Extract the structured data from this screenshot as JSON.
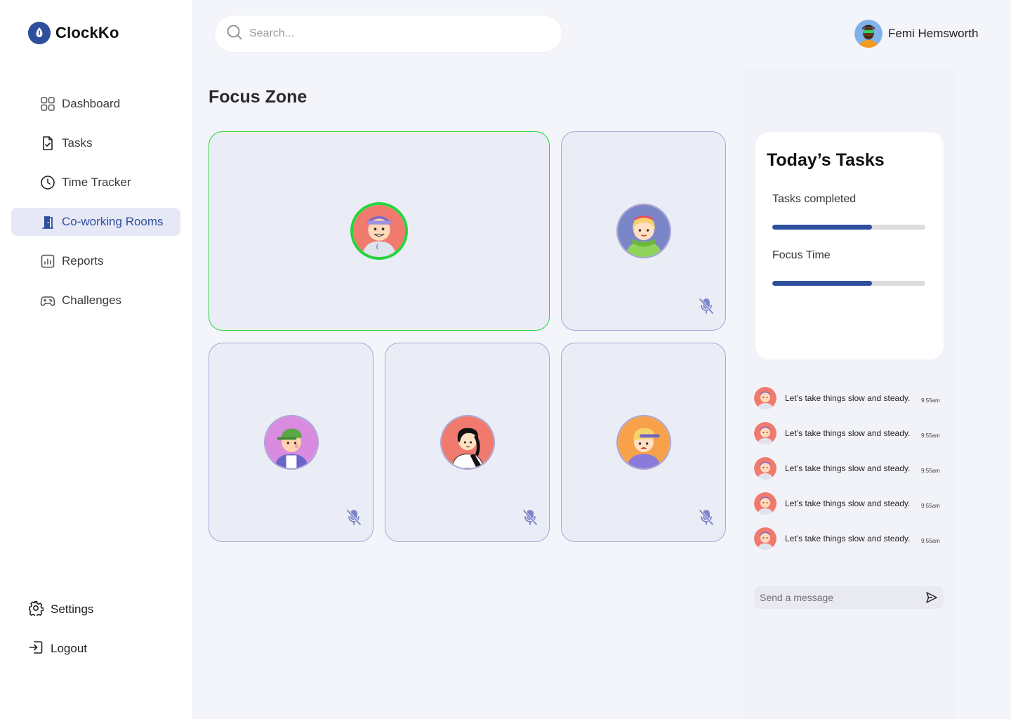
{
  "app": {
    "name": "ClockKo",
    "accent_color": "#2e4f9c",
    "speaking_color": "#22d639"
  },
  "sidebar": {
    "items": [
      {
        "label": "Dashboard",
        "icon": "grid-icon"
      },
      {
        "label": "Tasks",
        "icon": "task-file-icon"
      },
      {
        "label": "Time Tracker",
        "icon": "clock-icon"
      },
      {
        "label": "Co-working Rooms",
        "icon": "door-icon",
        "active": true
      },
      {
        "label": "Reports",
        "icon": "bar-chart-icon"
      },
      {
        "label": "Challenges",
        "icon": "gamepad-icon"
      }
    ],
    "settings_label": "Settings",
    "logout_label": "Logout"
  },
  "search": {
    "placeholder": "Search..."
  },
  "user": {
    "name": "Femi Hemsworth"
  },
  "main": {
    "title": "Focus Zone",
    "participants": [
      {
        "avatar": "astronaut-boy-avatar",
        "bg": "#f07a6e",
        "speaking": true,
        "muted": false
      },
      {
        "avatar": "blonde-girl-avatar",
        "bg": "#7b86c8",
        "speaking": false,
        "muted": true
      },
      {
        "avatar": "green-cap-boy-avatar",
        "bg": "#d98be0",
        "speaking": false,
        "muted": true
      },
      {
        "avatar": "black-hair-girl-avatar",
        "bg": "#f07a6e",
        "speaking": false,
        "muted": true
      },
      {
        "avatar": "yellow-cap-boy-avatar",
        "bg": "#f7a24a",
        "speaking": false,
        "muted": true
      }
    ]
  },
  "tasks": {
    "title": "Today’s Tasks",
    "items": [
      {
        "label": "Tasks completed",
        "progress": 0.65
      },
      {
        "label": "Focus Time",
        "progress": 0.65
      }
    ]
  },
  "chat": {
    "messages": [
      {
        "text": "Let’s take things slow and steady.",
        "time": "9:55am"
      },
      {
        "text": "Let’s take things slow and steady.",
        "time": "9:55am"
      },
      {
        "text": "Let’s take things slow and steady.",
        "time": "9:55am"
      },
      {
        "text": "Let’s take things slow and steady.",
        "time": "9:55am"
      },
      {
        "text": "Let’s take things slow and steady.",
        "time": "9:55am"
      }
    ],
    "input_placeholder": "Send a message"
  }
}
